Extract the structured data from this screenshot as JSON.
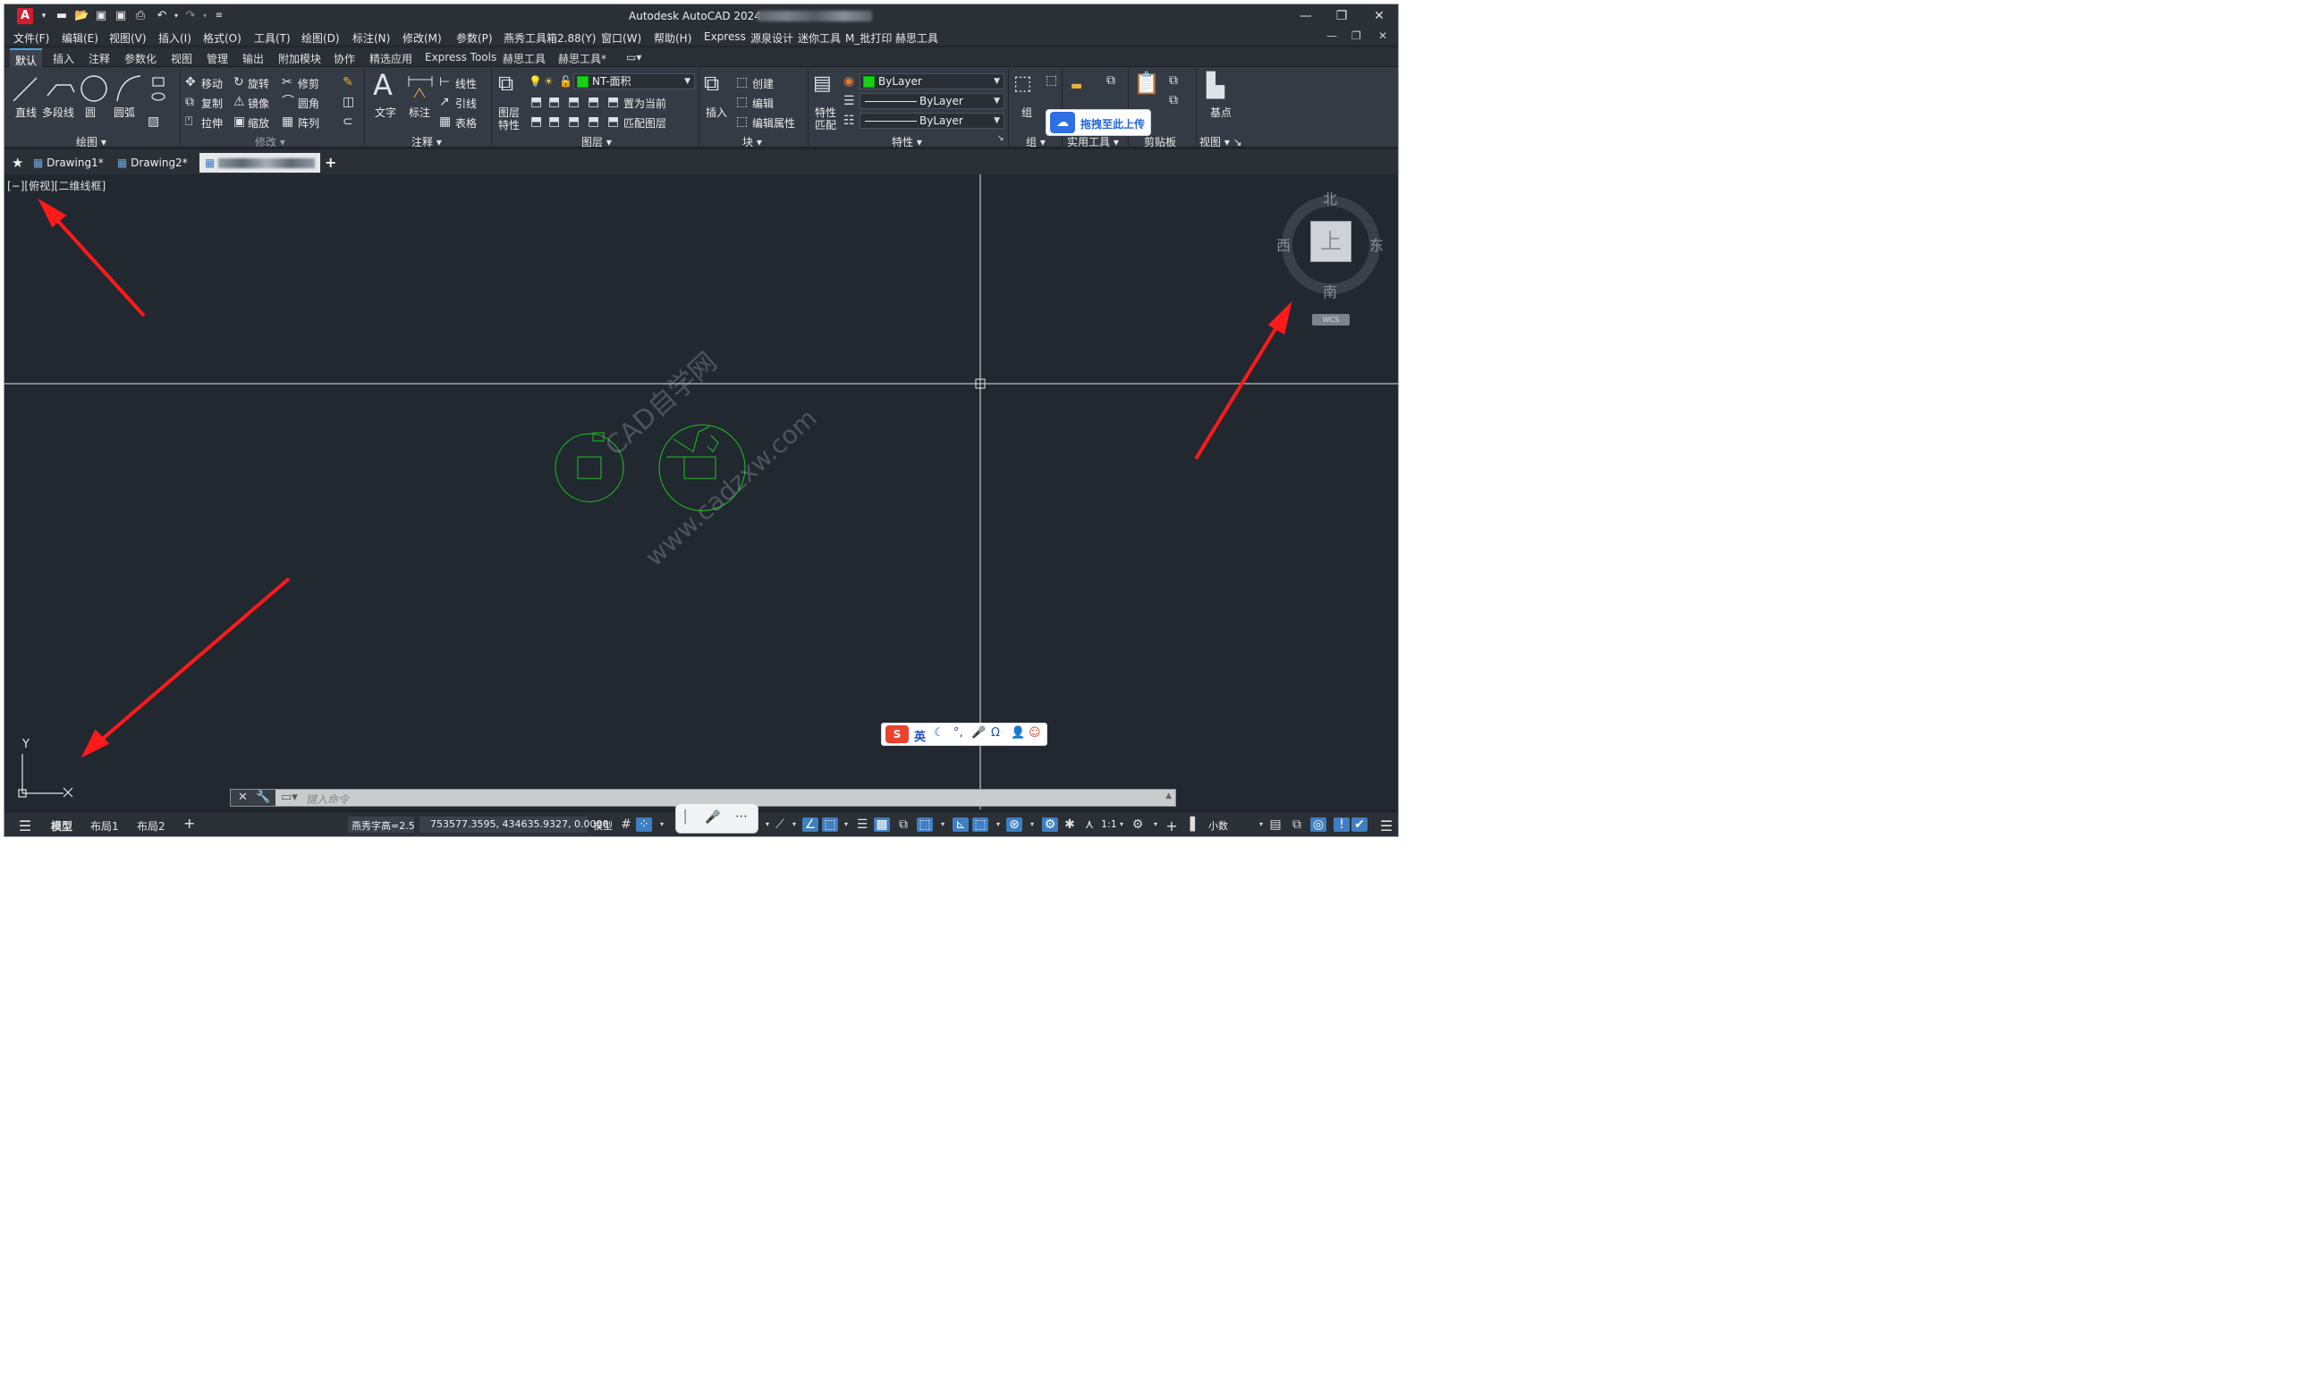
{
  "app": {
    "title": "Autodesk AutoCAD 2024"
  },
  "quick_access": [
    "new-icon",
    "open-icon",
    "save-icon",
    "saveas-icon",
    "plot-icon",
    "undo-icon",
    "redo-icon",
    "customize-icon"
  ],
  "menu": {
    "items": [
      "文件(F)",
      "编辑(E)",
      "视图(V)",
      "插入(I)",
      "格式(O)",
      "工具(T)",
      "绘图(D)",
      "标注(N)",
      "修改(M)",
      "参数(P)",
      "燕秀工具箱2.88(Y)",
      "窗口(W)",
      "帮助(H)",
      "Express",
      "源泉设计",
      "迷你工具",
      "M_批打印",
      "赫思工具"
    ]
  },
  "ribbon_tabs": [
    "默认",
    "插入",
    "注释",
    "参数化",
    "视图",
    "管理",
    "输出",
    "附加模块",
    "协作",
    "精选应用",
    "Express Tools",
    "赫思工具",
    "赫思工具*"
  ],
  "ribbon": {
    "draw": {
      "title": "绘图",
      "line": "直线",
      "polyline": "多段线",
      "circle": "圆",
      "arc": "圆弧"
    },
    "modify": {
      "title": "修改",
      "move": "移动",
      "rotate": "旋转",
      "trim": "修剪",
      "copy": "复制",
      "mirror": "镜像",
      "fillet": "圆角",
      "stretch": "拉伸",
      "scale": "缩放",
      "array": "阵列"
    },
    "annotation": {
      "title": "注释",
      "text": "文字",
      "dimension": "标注",
      "linear": "线性",
      "leader": "引线",
      "table": "表格"
    },
    "layers": {
      "title": "图层",
      "layer_props_line1": "图层",
      "layer_props_line2": "特性",
      "current_layer": "NT-面积",
      "make_current": "置为当前",
      "match_layer": "匹配图层"
    },
    "block": {
      "title": "块",
      "insert": "插入",
      "create": "创建",
      "edit": "编辑",
      "edit_attr": "编辑属性"
    },
    "properties": {
      "title": "特性",
      "match_line1": "特性",
      "match_line2": "匹配",
      "color": "ByLayer",
      "linetype": "ByLayer",
      "lineweight": "ByLayer"
    },
    "group": {
      "title": "组",
      "group": "组"
    },
    "utilities": {
      "title": "实用工具"
    },
    "clipboard": {
      "title": "剪贴板"
    },
    "view": {
      "title": "视图",
      "base": "基点"
    }
  },
  "cloud_upload": {
    "label": "拖拽至此上传"
  },
  "file_tabs": {
    "tabs": [
      "Drawing1*",
      "Drawing2*"
    ],
    "new_tab": "+"
  },
  "viewport": {
    "label": "[−][俯视][二维线框]"
  },
  "viewcube": {
    "north": "北",
    "south": "南",
    "east": "东",
    "west": "西",
    "top": "上",
    "wcs": "WCS"
  },
  "ucs": {
    "y_label": "Y",
    "x_label": "X"
  },
  "watermark": {
    "line1": "CAD自学网",
    "line2": "www.cadzxw.com"
  },
  "ime": {
    "mode": "英"
  },
  "command_line": {
    "placeholder": "键入命令"
  },
  "status_bar": {
    "tabs": [
      "模型",
      "布局1",
      "布局2"
    ],
    "add": "+",
    "text_height": "燕秀字高=2.5",
    "coords": "753577.3595, 434635.9327, 0.0000",
    "space": "模型",
    "scale": "1:1",
    "units": "小数"
  },
  "colors": {
    "background": "#212830",
    "accent": "#4aa3df",
    "drawing_green": "#1fc21f",
    "arrow_red": "#ff1a1a"
  }
}
